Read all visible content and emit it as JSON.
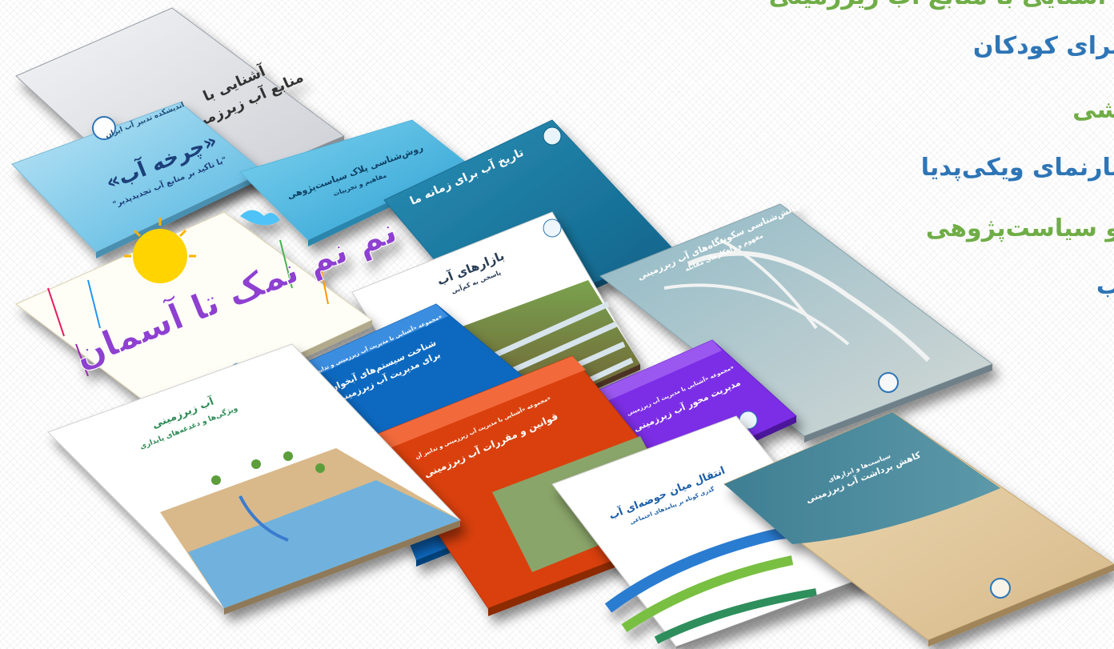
{
  "colors": {
    "blue_text": "#2e75b6",
    "green_text": "#70ad47"
  },
  "side_menu": {
    "lines": [
      {
        "text": "آشنایی با منابع آب زیرزمینی",
        "color": "green"
      },
      {
        "text": "برای کودکان",
        "color": "blue"
      },
      {
        "text": "شی",
        "color": "green"
      },
      {
        "text": "تارنمای ویکی‌پدیا",
        "color": "blue"
      },
      {
        "text": "و سیاست‌پژوهی",
        "color": "green"
      },
      {
        "text": "ب",
        "color": "blue"
      }
    ]
  },
  "books": {
    "b1": {
      "title": "آشنایی با",
      "subtitle": "منابع آب زیرزمینی"
    },
    "b2": {
      "org": "اندیشکده تدبیر آب ایران",
      "title": "«چرخه آب»",
      "subtitle": "\"با تاکید بر منابع آب تجدیدپذیر\""
    },
    "b3": {
      "title": "روش‌شناسی پلاک سیاست‌پژوهی",
      "subtitle": "مفاهیم و تجربیات"
    },
    "b4": {
      "title": "تاریخ آب برای زمانه ما"
    },
    "b5": {
      "title": "نم نم نمک تا آسمان"
    },
    "b6": {
      "title": "بازارهای آب",
      "subtitle": "پاسخی به کم‌آبی"
    },
    "b7": {
      "title": "چالش‌شناسی سکونتگاه‌های آب زیرزمینی",
      "subtitle": "مفهوم و راهکارهای مقابله"
    },
    "b8": {
      "series": "مجموعه «آشنایی با مدیریت آب زیرزمینی و تدابیر آن»",
      "title": "شناخت سیستم‌های آبخوان",
      "subtitle": "برای مدیریت آب زیرزمینی"
    },
    "b9": {
      "title": "آب زیرزمینی",
      "subtitle": "ویژگی‌ها و دغدغه‌های پایداری"
    },
    "b10": {
      "series": "مجموعه «آشنایی با مدیریت آب زیرزمینی و تدابیر آن»",
      "title": "قوانین و مقررات آب زیرزمینی"
    },
    "b11": {
      "series": "مجموعه «آشنایی با مدیریت آب زیرزمینی»",
      "title": "مدیریت محور آب زیرزمینی"
    },
    "b12": {
      "title": "انتقال میان حوضه‌ای آب",
      "subtitle": "گذری کوتاه بر پیامدهای اجتماعی"
    },
    "b13": {
      "series": "سیاست‌ها و ابزارهای",
      "title": "کاهش برداشت آب زیرزمینی"
    }
  }
}
